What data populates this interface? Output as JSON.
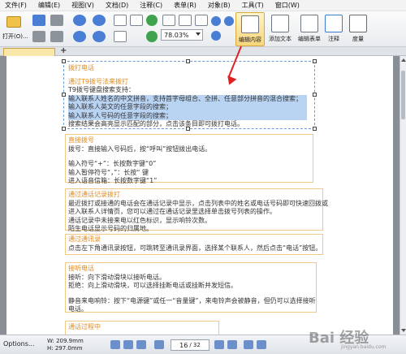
{
  "menu": [
    "文件(F)",
    "编辑(E)",
    "视图(V)",
    "文档(D)",
    "注释(C)",
    "表单(R)",
    "对象(B)",
    "工具(T)",
    "窗口(W)"
  ],
  "toolbar": {
    "open_label": "打开(O)...",
    "zoom_value": "78.03%",
    "edit_content_label": "编辑内容",
    "add_text_label": "添加文本",
    "edit_form_label": "编辑表单",
    "annotation_label": "注释",
    "measure_label": "度量"
  },
  "document": {
    "block1": {
      "heading": "拨打电话",
      "subheading": "通过T9拨号法来拨打",
      "lines": [
        "T9拨号键盘搜索支持：",
        "输入联系人姓名的中文拼音，支持首字母组合、全拼、任意部分拼音的混合搜索；",
        "输入联系人英文的任意字段的搜索；",
        "输入联系人号码的任意字段的搜索；",
        "搜索结果会高亮显示匹配的部分，点击该条目即可拨打电话。"
      ]
    },
    "block2": {
      "heading": "直接拨号",
      "lines": [
        "拨号：直接输入号码后，按“呼叫”按钮拨出电话。",
        "",
        "输入符号“+”：长按数字键“0”",
        "输入暂停符号“，”：长按“ 键",
        "进入语音信箱：长按数字键“1”"
      ]
    },
    "block3": {
      "heading": "通过通话记录拨打",
      "lines": [
        "最近拨打或接通的电话会在通话记录中显示，点击列表中的姓名或电话号码即可快速回拨或",
        "进入联系人详情页，您可以通过在通话记录里选择单击拨号列表的操作。",
        "通话记录中未接来电以红色标识，显示响铃次数。",
        "陌生电话显示号码的归属地。"
      ]
    },
    "block4": {
      "heading": "通过通讯录",
      "lines": [
        "点击左下角通讯录按钮，可跳转至通讯录界面，选择某个联系人，然后点击“电话”按钮。"
      ]
    },
    "block5": {
      "heading": "接听电话",
      "lines": [
        "接听：向下滑动滑块以接听电话。",
        "拒绝：向上滑动滑块，可以选择挂断电话或挂断并发短信。",
        "",
        "静音来电响铃：按下“电源键”或任一“音量键”，来电铃声会被静音，但仍可以选择接听",
        "电话。"
      ]
    },
    "block6": {
      "heading": "通话过程中"
    }
  },
  "status": {
    "options_label": "Options...",
    "width_label": "W: 209.9mm",
    "height_label": "H: 297.0mm",
    "page_current": "16",
    "page_total": "/ 32"
  },
  "watermark": {
    "main": "Bai 经验",
    "sub": "jingyan.baidu.com"
  },
  "colors": {
    "accent_orange": "#e08a1d",
    "selection_blue": "#b9d3f3",
    "arrow_red": "#e02020"
  }
}
